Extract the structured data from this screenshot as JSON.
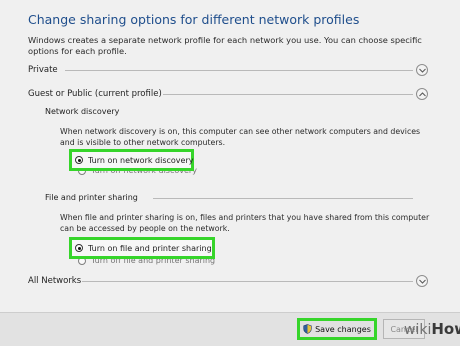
{
  "header": {
    "title": "Change sharing options for different network profiles",
    "description": "Windows creates a separate network profile for each network you use. You can choose specific options for each profile."
  },
  "profiles": {
    "private": {
      "label": "Private"
    },
    "guest_public": {
      "label": "Guest or Public (current profile)"
    },
    "all_networks": {
      "label": "All Networks"
    }
  },
  "network_discovery": {
    "heading": "Network discovery",
    "description": "When network discovery is on, this computer can see other network computers and devices and is visible to other network computers.",
    "option_on": "Turn on network discovery",
    "option_off": "Turn off network discovery",
    "selected": "on"
  },
  "file_sharing": {
    "heading": "File and printer sharing",
    "description": "When file and printer sharing is on, files and printers that you have shared from this computer can be accessed by people on the network.",
    "option_on": "Turn on file and printer sharing",
    "option_off": "Turn off file and printer sharing",
    "selected": "on"
  },
  "footer": {
    "save_label": "Save changes",
    "cancel_label": "Cancel"
  },
  "watermark": {
    "part1": "wiki",
    "part2": "How"
  },
  "colors": {
    "title": "#1f4e8c",
    "highlight": "#36d52a",
    "background": "#f0f0f0"
  },
  "icons": {
    "expand": "chevron-down-icon",
    "collapse": "chevron-up-icon",
    "shield": "shield-icon"
  }
}
